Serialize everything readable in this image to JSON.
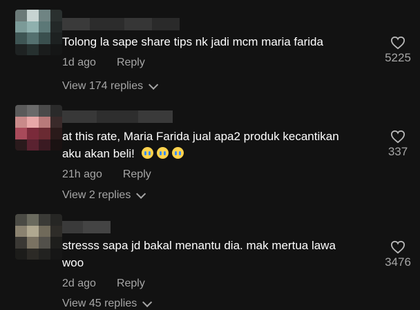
{
  "comments": [
    {
      "text": "Tolong la sape share tips nk jadi mcm maria farida",
      "time": "1d ago",
      "reply_label": "Reply",
      "likes": "5225",
      "view_replies": "View 174 replies"
    },
    {
      "text": "at this rate, Maria Farida jual apa2 produk kecantikan aku akan beli!",
      "emojis": "😭😭😭",
      "time": "21h ago",
      "reply_label": "Reply",
      "likes": "337",
      "view_replies": "View 2 replies"
    },
    {
      "text": "stresss sapa jd bakal menantu dia. mak mertua lawa woo",
      "time": "2d ago",
      "reply_label": "Reply",
      "likes": "3476",
      "view_replies": "View 45 replies"
    }
  ],
  "colors": {
    "background": "#121212",
    "secondary_text": "#a6a6a6"
  },
  "icons": {
    "like": "heart-outline-icon",
    "expand": "chevron-down-icon"
  }
}
